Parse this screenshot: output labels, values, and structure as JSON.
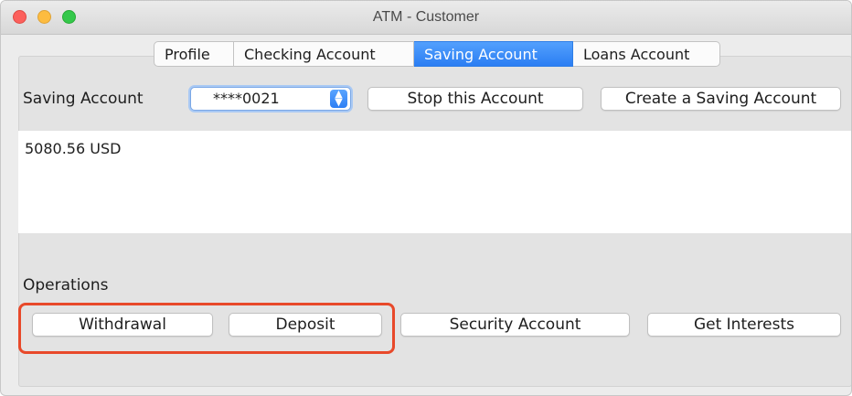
{
  "window": {
    "title": "ATM - Customer"
  },
  "tabs": [
    {
      "label": "Profile",
      "active": false
    },
    {
      "label": "Checking Account",
      "active": false
    },
    {
      "label": "Saving Account",
      "active": true
    },
    {
      "label": "Loans Account",
      "active": false
    }
  ],
  "account_row": {
    "label": "Saving Account",
    "selected_account": "****0021",
    "stop_button": "Stop this Account",
    "create_button": "Create a Saving Account"
  },
  "balance_text": "5080.56 USD",
  "operations": {
    "label": "Operations",
    "withdrawal": "Withdrawal",
    "deposit": "Deposit",
    "security": "Security Account",
    "interests": "Get Interests"
  },
  "colors": {
    "accent": "#2b7ef3",
    "highlight_border": "#e8492a"
  }
}
